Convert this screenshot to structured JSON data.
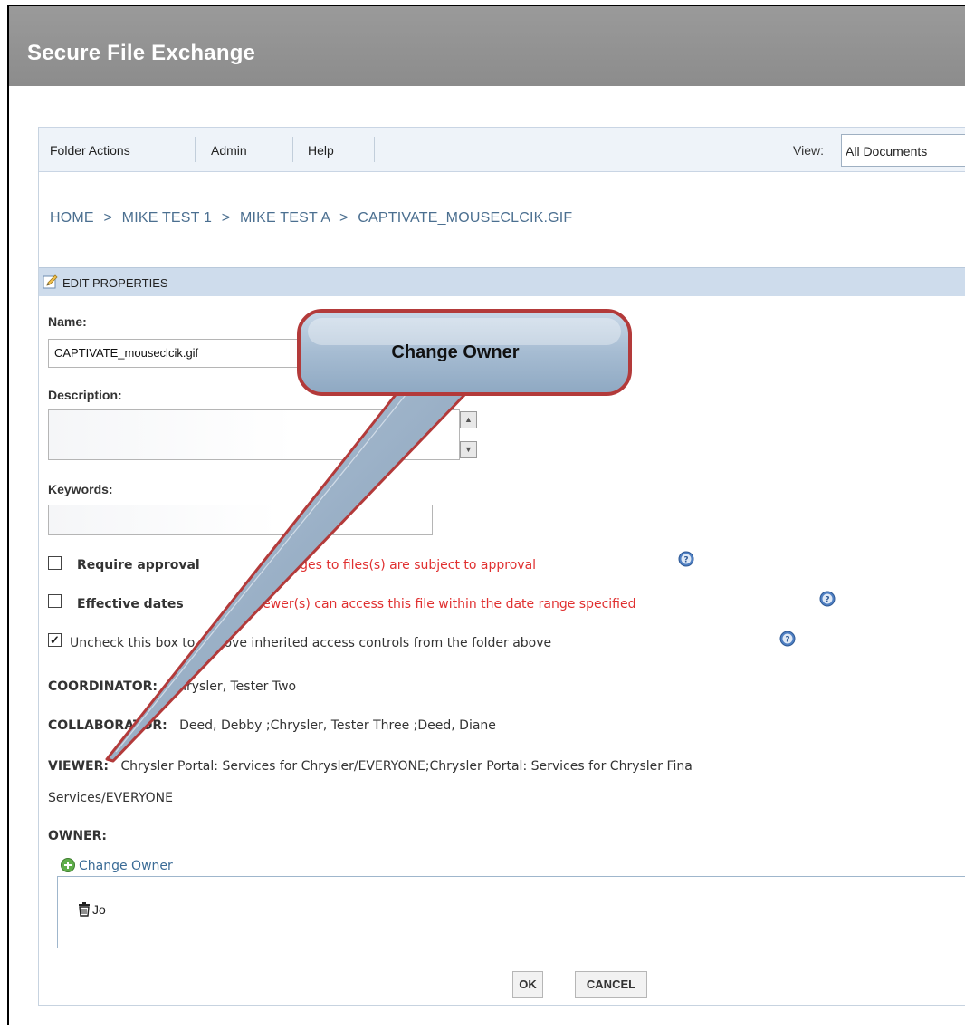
{
  "app": {
    "title": "Secure File Exchange"
  },
  "menubar": {
    "items": [
      "Folder Actions",
      "Admin",
      "Help"
    ],
    "view_label": "View:",
    "view_value": "All Documents"
  },
  "breadcrumb": [
    "HOME",
    "MIKE TEST 1",
    "MIKE TEST A",
    "CAPTIVATE_MOUSECLCIK.GIF"
  ],
  "breadcrumb_separator": ">",
  "edit_properties": {
    "header": "EDIT PROPERTIES",
    "name_label": "Name:",
    "name_value": "CAPTIVATE_mouseclcik.gif",
    "description_label": "Description:",
    "description_value": "",
    "keywords_label": "Keywords:",
    "keywords_value": ""
  },
  "options": {
    "require_approval": {
      "label": "Require approval",
      "note": "Changes to files(s) are subject to approval",
      "checked": false
    },
    "effective_dates": {
      "label": "Effective dates",
      "note": "Viewer(s) can access this file within the date range specified",
      "checked": false
    },
    "inherit": {
      "label": "Uncheck this box to remove inherited access controls from the folder above",
      "checked": true
    }
  },
  "roles": {
    "coordinator_label": "COORDINATOR:",
    "coordinator_value": "Chrysler, Tester Two",
    "collaborator_label": "COLLABORATOR:",
    "collaborator_value": "Deed, Debby ;Chrysler, Tester Three ;Deed, Diane",
    "viewer_label": "VIEWER:",
    "viewer_value_line1": "Chrysler Portal: Services for Chrysler/EVERYONE;Chrysler Portal: Services for Chrysler Fina",
    "viewer_value_line2": "Services/EVERYONE",
    "owner_label": "OWNER:"
  },
  "owner": {
    "change_link": "Change Owner",
    "entry": "Jo"
  },
  "buttons": {
    "ok": "OK",
    "cancel": "CANCEL"
  },
  "callout": {
    "text": "Change Owner"
  },
  "colors": {
    "title_bar": "#8f8f8f",
    "menubar": "#eef3f9",
    "section_header": "#cedcec",
    "note_red": "#e03030",
    "link_blue": "#3a6b96",
    "callout_border": "#b33a3a",
    "callout_fill": "#a9bfd4"
  },
  "icons": {
    "pencil": "pencil-edit-icon",
    "help": "help-icon",
    "add": "add-circle-icon",
    "trash": "trash-icon"
  }
}
